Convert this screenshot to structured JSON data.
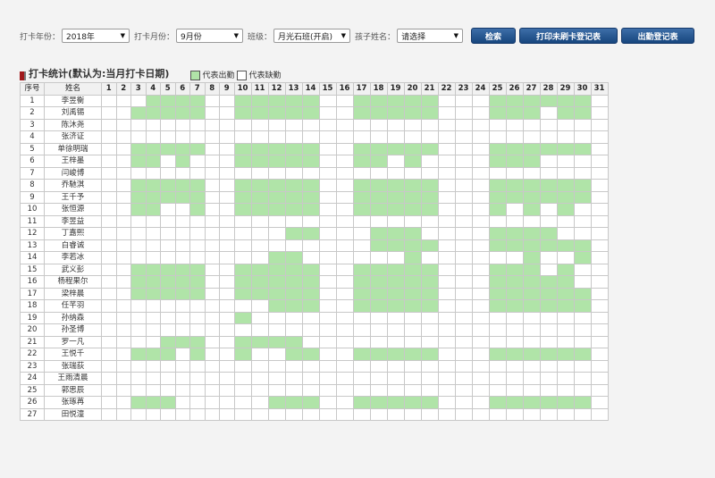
{
  "filters": {
    "year_label": "打卡年份：",
    "year_value": "2018年",
    "month_label": "打卡月份：",
    "month_value": "9月份",
    "class_label": "班级：",
    "class_value": "月光石班(开启)",
    "child_label": "孩子姓名：",
    "child_value": "请选择"
  },
  "buttons": {
    "search": "检索",
    "print_unswiped": "打印未刷卡登记表",
    "attendance_register": "出勤登记表"
  },
  "section": {
    "title": "打卡统计(默认为:当月打卡日期)",
    "legend_present": "代表出勤",
    "legend_absent": "代表缺勤"
  },
  "colors": {
    "present": "#b0e4a8",
    "absent": "#ffffff",
    "button": "#1f4f8a",
    "title_mark": "#a0191b"
  },
  "table": {
    "headers": {
      "index": "序号",
      "name": "姓名"
    },
    "days": [
      1,
      2,
      3,
      4,
      5,
      6,
      7,
      8,
      9,
      10,
      11,
      12,
      13,
      14,
      15,
      16,
      17,
      18,
      19,
      20,
      21,
      22,
      23,
      24,
      25,
      26,
      27,
      28,
      29,
      30,
      31
    ],
    "rows": [
      {
        "no": "1",
        "name": "李昱衡",
        "present": [
          4,
          5,
          6,
          7,
          10,
          11,
          12,
          13,
          14,
          17,
          18,
          19,
          20,
          21,
          25,
          26,
          27,
          28,
          29,
          30
        ]
      },
      {
        "no": "2",
        "name": "刘禹锡",
        "present": [
          3,
          4,
          5,
          6,
          7,
          10,
          11,
          12,
          13,
          14,
          17,
          18,
          19,
          20,
          21,
          25,
          26,
          27,
          29,
          30
        ]
      },
      {
        "no": "3",
        "name": "陈沐尧",
        "present": []
      },
      {
        "no": "4",
        "name": "张济证",
        "present": []
      },
      {
        "no": "5",
        "name": "单徐明瑞",
        "present": [
          3,
          4,
          5,
          6,
          7,
          10,
          11,
          12,
          13,
          14,
          17,
          18,
          19,
          20,
          21,
          25,
          26,
          27,
          28,
          29,
          30
        ]
      },
      {
        "no": "6",
        "name": "王梓墨",
        "present": [
          3,
          4,
          6,
          10,
          11,
          12,
          13,
          14,
          17,
          18,
          20,
          25,
          26,
          27
        ]
      },
      {
        "no": "7",
        "name": "闫峻博",
        "present": []
      },
      {
        "no": "8",
        "name": "乔馳淇",
        "present": [
          3,
          4,
          5,
          6,
          7,
          10,
          11,
          12,
          13,
          14,
          17,
          18,
          19,
          20,
          21,
          25,
          26,
          27,
          28,
          29,
          30
        ]
      },
      {
        "no": "9",
        "name": "王千予",
        "present": [
          3,
          4,
          5,
          6,
          7,
          10,
          11,
          12,
          13,
          14,
          17,
          18,
          19,
          20,
          21,
          25,
          26,
          27,
          28,
          29,
          30
        ]
      },
      {
        "no": "10",
        "name": "张恒源",
        "present": [
          3,
          4,
          7,
          10,
          11,
          12,
          13,
          14,
          17,
          18,
          19,
          20,
          21,
          25,
          27,
          29
        ]
      },
      {
        "no": "11",
        "name": "李昱益",
        "present": []
      },
      {
        "no": "12",
        "name": "丁嘉熙",
        "present": [
          13,
          14,
          18,
          19,
          20,
          25,
          26,
          27,
          28
        ]
      },
      {
        "no": "13",
        "name": "白睿诚",
        "present": [
          18,
          19,
          20,
          21,
          25,
          26,
          27,
          28,
          29,
          30
        ]
      },
      {
        "no": "14",
        "name": "李若冰",
        "present": [
          12,
          13,
          20,
          27,
          30
        ]
      },
      {
        "no": "15",
        "name": "武义彭",
        "present": [
          3,
          4,
          5,
          6,
          7,
          10,
          11,
          12,
          13,
          14,
          17,
          18,
          19,
          20,
          21,
          25,
          26,
          27,
          29
        ]
      },
      {
        "no": "16",
        "name": "杨程果尔",
        "present": [
          3,
          4,
          5,
          6,
          7,
          10,
          11,
          12,
          13,
          14,
          17,
          18,
          19,
          20,
          21,
          25,
          26,
          27,
          28,
          29
        ]
      },
      {
        "no": "17",
        "name": "梁梓晨",
        "present": [
          3,
          4,
          5,
          6,
          7,
          10,
          11,
          12,
          13,
          14,
          17,
          18,
          19,
          20,
          21,
          25,
          26,
          27,
          28,
          29,
          30
        ]
      },
      {
        "no": "18",
        "name": "任芊羽",
        "present": [
          12,
          13,
          14,
          17,
          18,
          19,
          20,
          21,
          25,
          26,
          27,
          28,
          29,
          30
        ]
      },
      {
        "no": "19",
        "name": "孙纳森",
        "present": [
          10
        ]
      },
      {
        "no": "20",
        "name": "孙圣博",
        "present": []
      },
      {
        "no": "21",
        "name": "罗一凡",
        "present": [
          5,
          6,
          7,
          10,
          11,
          12,
          13
        ]
      },
      {
        "no": "22",
        "name": "王悦千",
        "present": [
          3,
          4,
          5,
          7,
          10,
          13,
          14,
          17,
          18,
          19,
          20,
          21,
          25,
          26,
          27,
          28,
          29,
          30
        ]
      },
      {
        "no": "23",
        "name": "张瑞荻",
        "present": []
      },
      {
        "no": "24",
        "name": "王雨清晨",
        "present": []
      },
      {
        "no": "25",
        "name": "郭思辰",
        "present": []
      },
      {
        "no": "26",
        "name": "张琢苒",
        "present": [
          3,
          4,
          5,
          12,
          13,
          14,
          17,
          18,
          19,
          20,
          21,
          25,
          26,
          27,
          28,
          29,
          30
        ]
      },
      {
        "no": "27",
        "name": "田悦潼",
        "present": []
      }
    ]
  }
}
